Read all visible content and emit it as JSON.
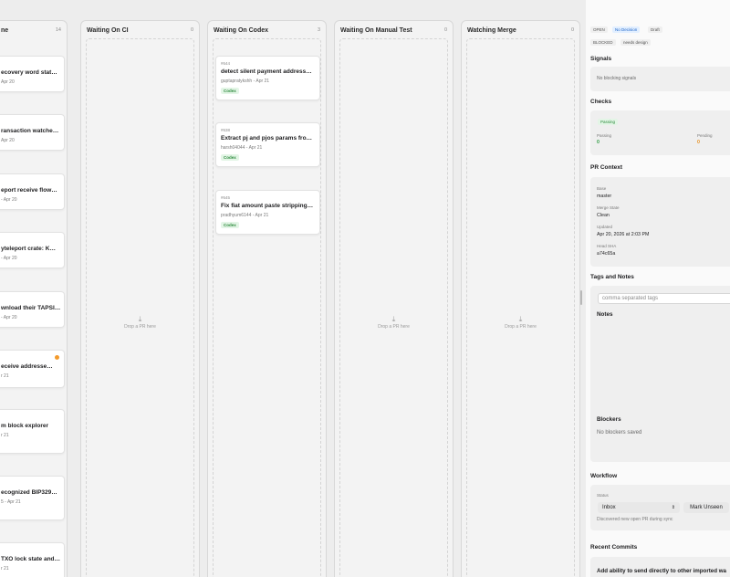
{
  "board": {
    "left_column": {
      "title": "ne",
      "count": "14",
      "cards": [
        {
          "title": "ecovery word stat…",
          "meta": "Apr 20"
        },
        {
          "title": "ransaction watche…",
          "meta": "Apr 20"
        },
        {
          "title": "eport receive flow…",
          "meta": "- Apr 20"
        },
        {
          "title": "yteleport crate: K…",
          "meta": "- Apr 20"
        },
        {
          "title": "wnload their TAPSI…",
          "meta": "- Apr 20"
        },
        {
          "title": "eceive addresse…",
          "meta": "r 21"
        },
        {
          "title": "m block explorer",
          "meta": "r 21"
        },
        {
          "title": "ecognized BIP329…",
          "meta": "5 - Apr 21"
        },
        {
          "title": "TXO lock state and…",
          "meta": "r 21"
        }
      ]
    },
    "columns": [
      {
        "title": "Waiting On CI",
        "count": "0",
        "drop_text": "Drop a PR here"
      },
      {
        "title": "Waiting On Codex",
        "count": "3",
        "drop_text": "",
        "cards": [
          {
            "number": "#644",
            "title": "detect silent payment address…",
            "meta": "guptapratykshh - Apr 21",
            "badge": "Codex"
          },
          {
            "number": "#638",
            "title": "Extract pj and pjos params fro…",
            "meta": "harsh04044 - Apr 21",
            "badge": "Codex"
          },
          {
            "number": "#645",
            "title": "Fix fiat amount paste stripping…",
            "meta": "pradhyum6144 - Apr 21",
            "badge": "Codex"
          }
        ]
      },
      {
        "title": "Waiting On Manual Test",
        "count": "0",
        "drop_text": "Drop a PR here"
      },
      {
        "title": "Watching Merge",
        "count": "0",
        "drop_text": "Drop a PR here"
      }
    ]
  },
  "detail": {
    "pills": [
      "OPEN",
      "No Decision",
      "Draft"
    ],
    "tags": [
      "BLOCKED",
      "needs design"
    ],
    "signals": {
      "title": "Signals",
      "text": "No blocking signals"
    },
    "checks": {
      "title": "Checks",
      "badge": "Passing",
      "passing_label": "Passing",
      "passing_value": "0",
      "pending_label": "Pending",
      "pending_value": "0"
    },
    "pr_context": {
      "title": "PR Context",
      "fields": [
        {
          "label": "Base",
          "value": "master"
        },
        {
          "label": "Merge State",
          "value": "Clean"
        },
        {
          "label": "Updated",
          "value": "Apr 20, 2026 at 2:03 PM"
        },
        {
          "label": "Head SHA",
          "value": "a74c65a"
        }
      ]
    },
    "tags_notes": {
      "title": "Tags and Notes",
      "placeholder": "comma separated tags",
      "notes_label": "Notes",
      "blockers_label": "Blockers",
      "blockers_text": "No blockers saved"
    },
    "workflow": {
      "title": "Workflow",
      "status_label": "Status",
      "status_value": "Inbox",
      "mark_button": "Mark Unseen",
      "note": "Discovered new open PR during sync"
    },
    "recent_commits": {
      "title": "Recent Commits",
      "first_commit": "Add ability to send directly to other imported wa"
    }
  },
  "colors": {
    "accent_green": "#2e9b43",
    "pending_orange": "#e8901e",
    "blue_pill": "#1e64c8"
  }
}
